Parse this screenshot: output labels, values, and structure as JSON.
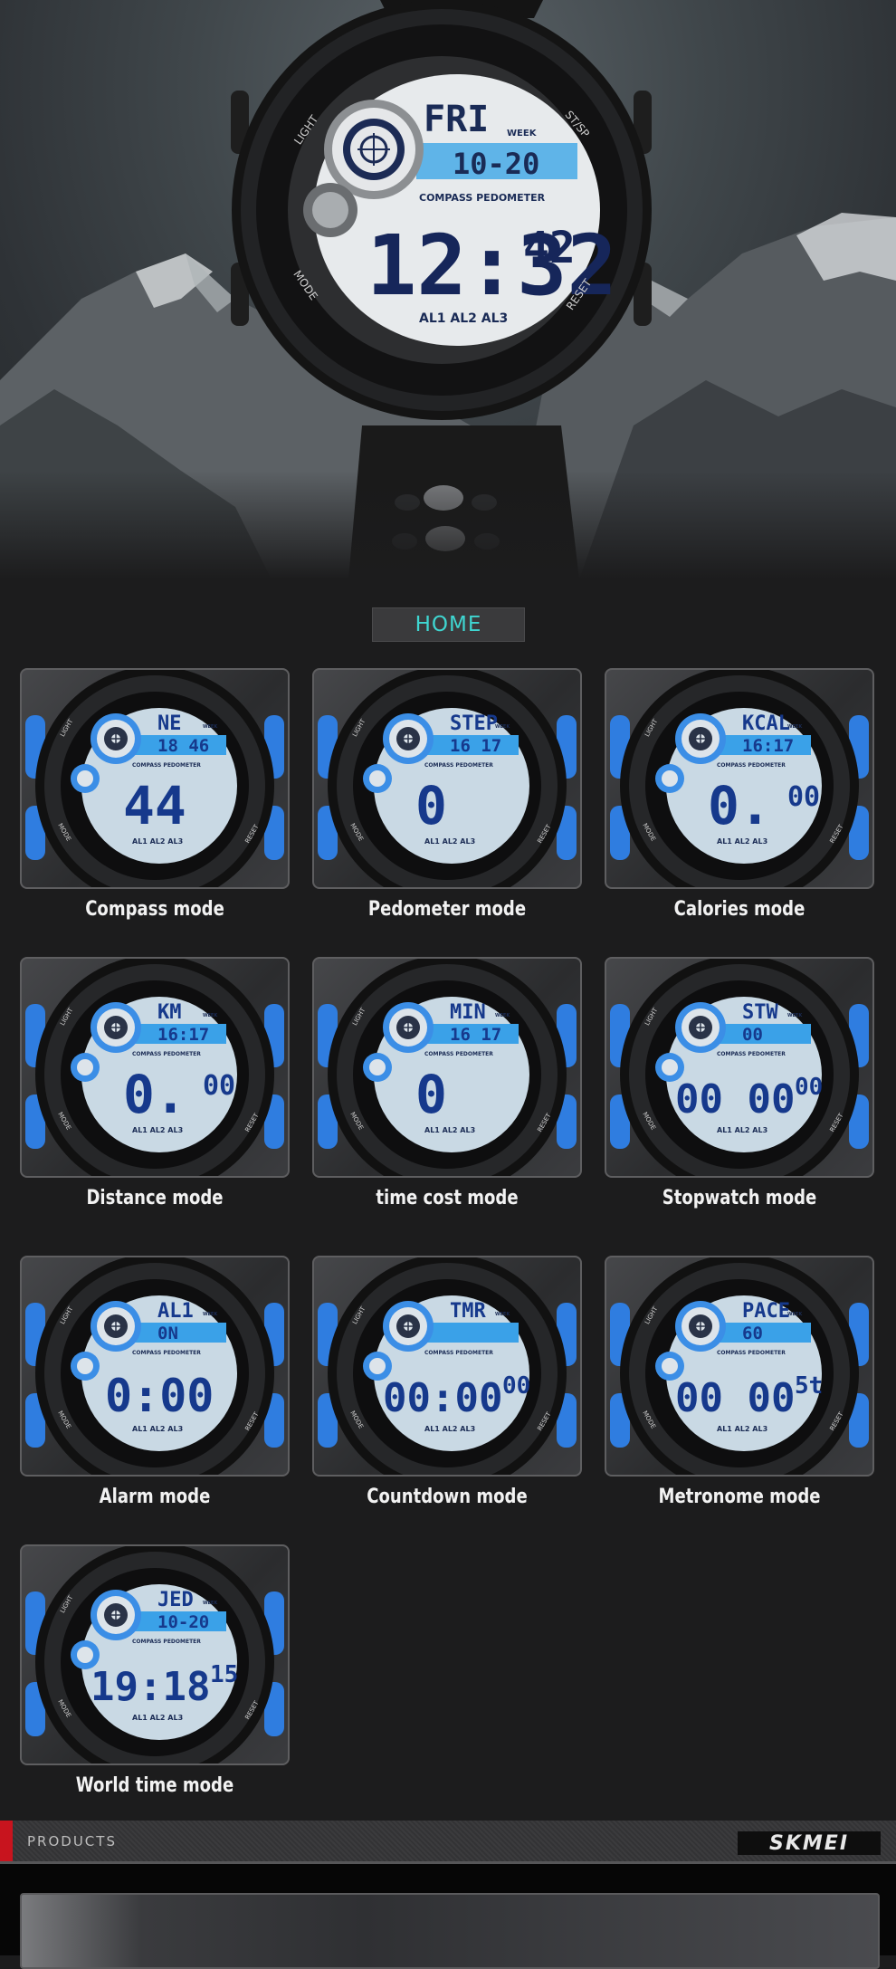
{
  "hero": {
    "watch": {
      "day": "FRI",
      "week_label": "WEEK",
      "date": "10-20",
      "mode_strip": "COMPASS PEDOMETER",
      "hour_min": "12:32",
      "seconds": "42",
      "alarms": "AL1 AL2 AL3",
      "bezel_labels": {
        "light": "LIGHT",
        "st_sp": "ST/SP",
        "mode": "MODE",
        "reset": "RESET"
      }
    }
  },
  "nav": {
    "home_label": "HOME"
  },
  "modes": [
    {
      "caption": "Compass mode",
      "top": "NE",
      "mid": "18 46",
      "big": "44",
      "small": ""
    },
    {
      "caption": "Pedometer mode",
      "top": "STEP",
      "mid": "16 17",
      "big": "0",
      "small": ""
    },
    {
      "caption": "Calories mode",
      "top": "KCAL",
      "mid": "16:17",
      "big": "0.",
      "small": "00"
    },
    {
      "caption": "Distance mode",
      "top": "KM",
      "mid": "16:17",
      "big": "0.",
      "small": "00"
    },
    {
      "caption": "time cost mode",
      "top": "MIN",
      "mid": "16 17",
      "big": "0",
      "small": ""
    },
    {
      "caption": "Stopwatch mode",
      "top": "STW",
      "mid": "00",
      "big": "00 00",
      "small": "00"
    },
    {
      "caption": "Alarm mode",
      "top": "AL1",
      "mid": "0N",
      "big": "0:00",
      "small": ""
    },
    {
      "caption": "Countdown mode",
      "top": "TMR",
      "mid": "",
      "big": "00:00",
      "small": "00"
    },
    {
      "caption": "Metronome mode",
      "top": "PACE",
      "mid": "60",
      "big": "00 00",
      "small": "5t"
    },
    {
      "caption": "World time mode",
      "top": "JED",
      "mid": "10-20",
      "big": "19:18",
      "small": "15"
    }
  ],
  "lcd_common": {
    "week": "WEEK",
    "strip": "COMPASS PEDOMETER",
    "alarms": "AL1 AL2 AL3",
    "light": "LIGHT",
    "mode": "MODE",
    "reset": "RESET"
  },
  "footer": {
    "products_label": "PRODUCTS",
    "brand_logo": "SKMEI"
  },
  "colors": {
    "accent_blue": "#2f7de0",
    "lcd_blue": "#16398c",
    "home_text": "#3fd6d1",
    "red_marker": "#c8141e"
  }
}
